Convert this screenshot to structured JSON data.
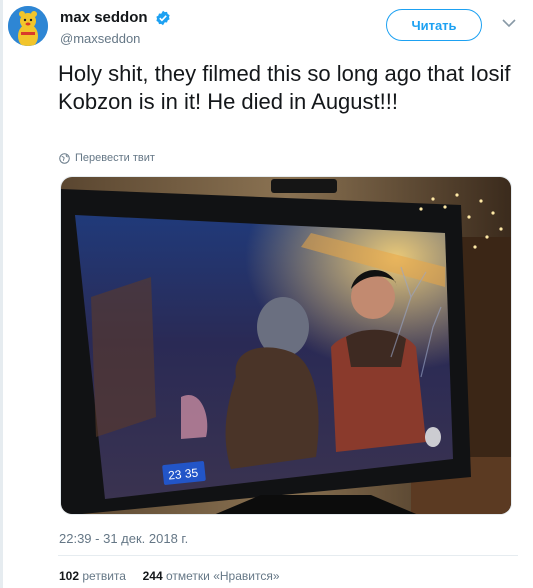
{
  "author": {
    "display_name": "max seddon",
    "handle": "@maxseddon",
    "avatar_icon": "cartoon-character-icon",
    "verified": true
  },
  "follow_button": {
    "label": "Читать"
  },
  "tweet": {
    "text": "Holy shit, they filmed this so long ago that Iosif Kobzon is in it! He died in August!!!",
    "translate_label": "Перевести твит",
    "timestamp": "22:39 - 31 дек. 2018 г."
  },
  "media": {
    "tv_clock": "23 35"
  },
  "stats": {
    "retweets_count": "102",
    "retweets_label": "ретвита",
    "likes_count": "244",
    "likes_label": "отметки «Нравится»"
  },
  "colors": {
    "accent": "#1da1f2",
    "text_primary": "#14171a",
    "text_secondary": "#657786"
  }
}
